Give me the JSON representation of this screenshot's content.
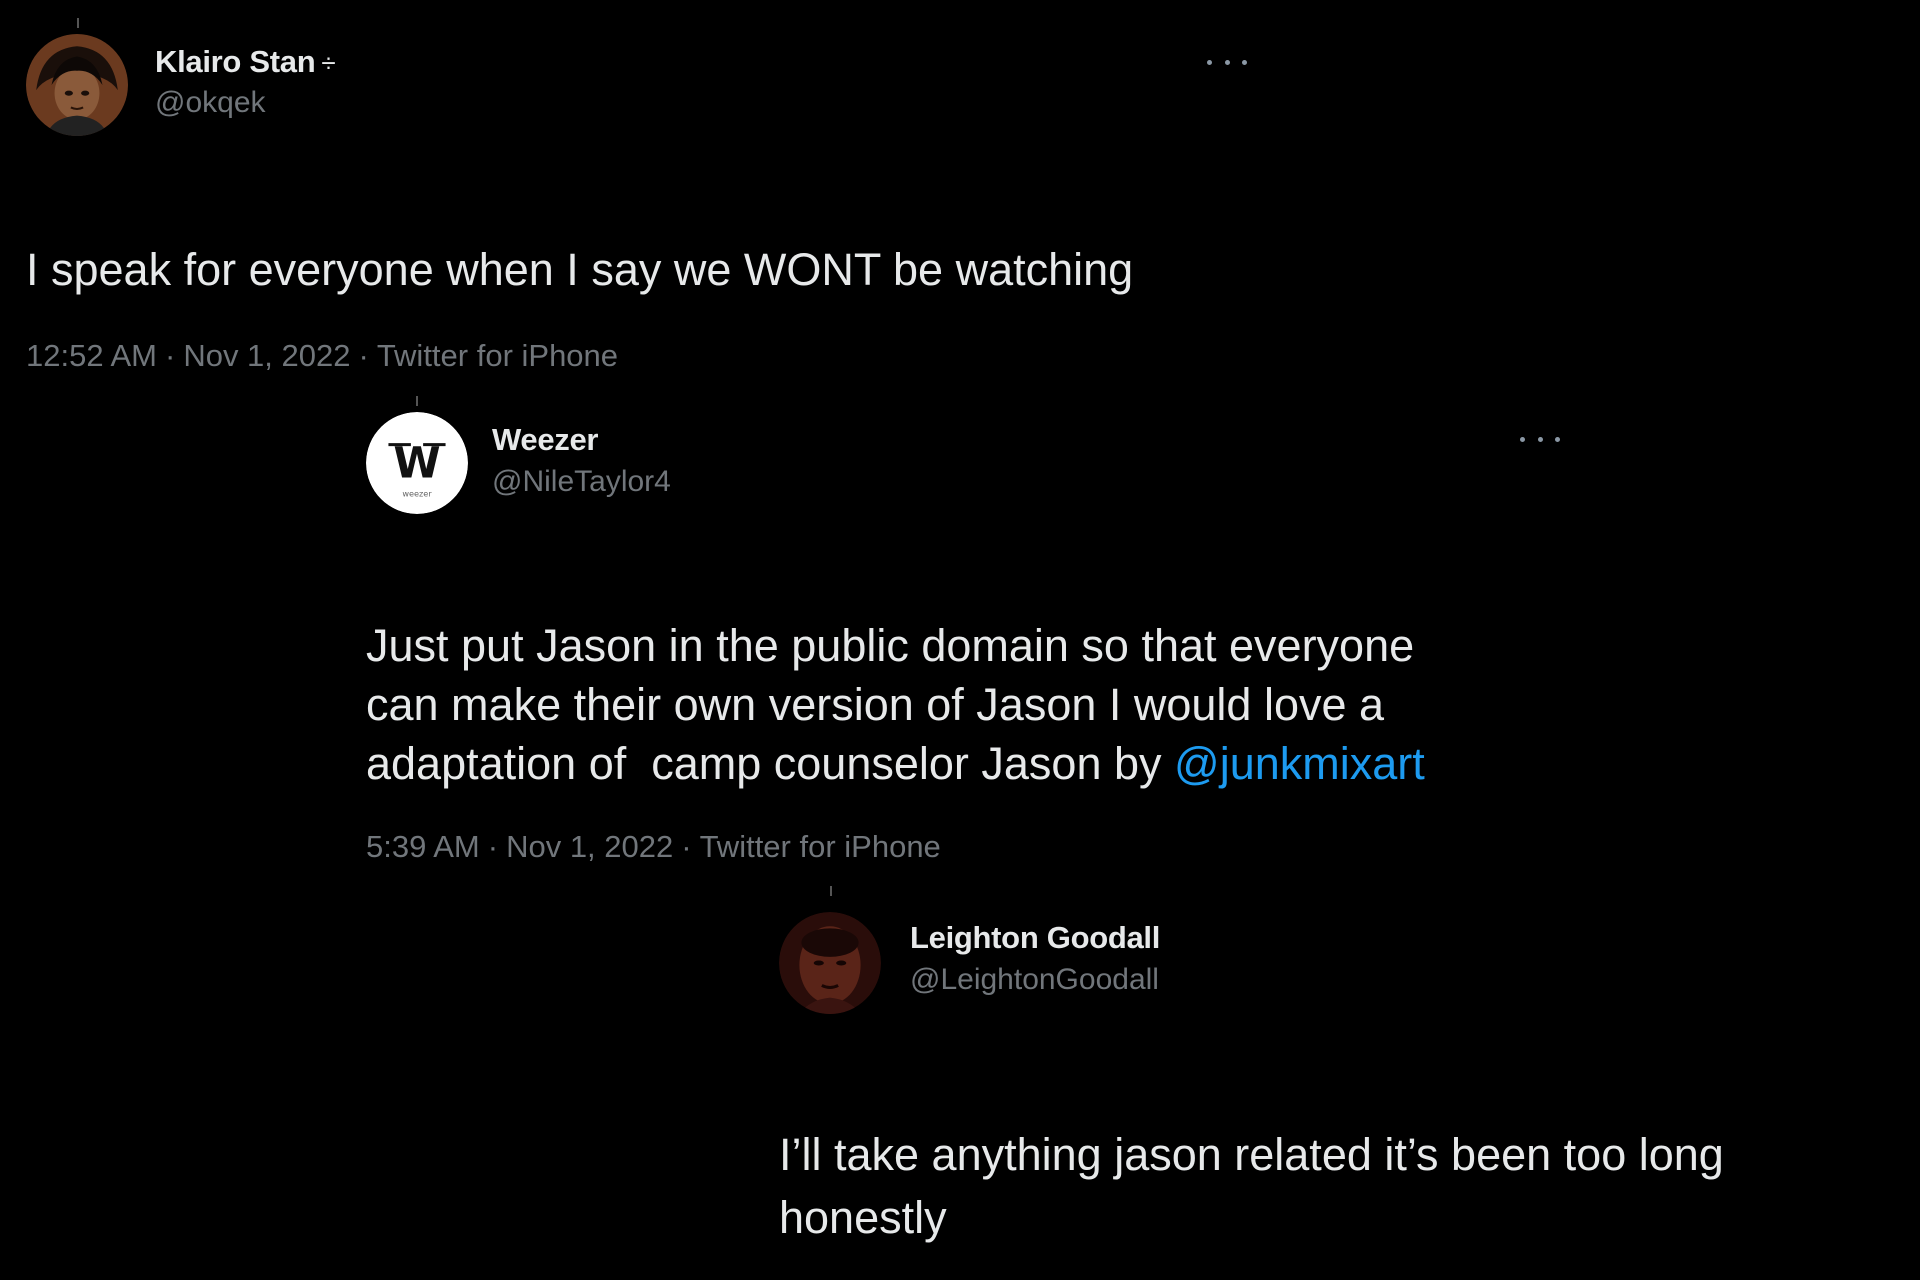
{
  "tweets": [
    {
      "display_name": "Klairo Stan",
      "verified_mark": "÷",
      "handle": "@okqek",
      "text": "I speak for everyone when I say we WONT be watching",
      "time": "12:52 AM",
      "date": "Nov 1, 2022",
      "source": "Twitter for iPhone",
      "separator": "·"
    },
    {
      "display_name": "Weezer",
      "handle": "@NileTaylor4",
      "avatar_logo_letter": "W",
      "avatar_logo_caption": "weezer",
      "text_lines": [
        "Just put Jason in the public domain so that everyone",
        "can make their own version of Jason I would love a",
        "adaptation of  camp counselor Jason by "
      ],
      "mention": "@junkmixart",
      "time": "5:39 AM",
      "date": "Nov 1, 2022",
      "source": "Twitter for iPhone",
      "separator": "·"
    },
    {
      "display_name": "Leighton Goodall",
      "handle": "@LeightonGoodall",
      "text_lines": [
        "I’ll take anything jason related it’s been too long",
        "honestly"
      ]
    }
  ],
  "colors": {
    "background": "#000000",
    "text": "#e7e9ea",
    "muted": "#71767b",
    "link": "#1d9bf0"
  },
  "icons": {
    "more": "more-horizontal-icon"
  }
}
